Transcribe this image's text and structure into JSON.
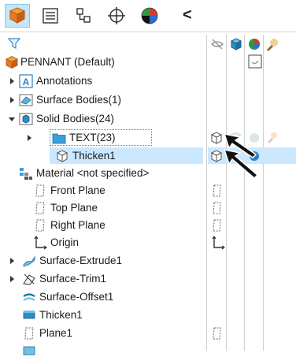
{
  "tabs": [
    {
      "icon": "feature-manager-icon",
      "active": true
    },
    {
      "icon": "property-manager-icon",
      "active": false
    },
    {
      "icon": "configuration-manager-icon",
      "active": false
    },
    {
      "icon": "dimxpert-manager-icon",
      "active": false
    },
    {
      "icon": "display-manager-icon",
      "active": false
    }
  ],
  "collapse_label": "<",
  "column_headers": [
    "hide-show-icon",
    "display-mode-icon",
    "appearance-icon",
    "transparency-icon"
  ],
  "tree": {
    "root": "PENNANT (Default)",
    "items": [
      {
        "label": "Annotations",
        "icon": "annotations-icon",
        "expander": "collapsed"
      },
      {
        "label": "Surface Bodies(1)",
        "icon": "surface-bodies-folder-icon",
        "expander": "collapsed"
      },
      {
        "label": "Solid Bodies(24)",
        "icon": "solid-bodies-folder-icon",
        "expander": "expanded"
      },
      {
        "label": "TEXT(23)",
        "icon": "folder-icon",
        "expander": "collapsed"
      },
      {
        "label": "Thicken1",
        "icon": "solid-body-icon",
        "expander": "none"
      },
      {
        "label": "Material <not specified>",
        "icon": "material-icon",
        "expander": "none"
      },
      {
        "label": "Front Plane",
        "icon": "plane-icon",
        "expander": "none"
      },
      {
        "label": "Top Plane",
        "icon": "plane-icon",
        "expander": "none"
      },
      {
        "label": "Right Plane",
        "icon": "plane-icon",
        "expander": "none"
      },
      {
        "label": "Origin",
        "icon": "origin-icon",
        "expander": "none"
      },
      {
        "label": "Surface-Extrude1",
        "icon": "surface-extrude-icon",
        "expander": "collapsed"
      },
      {
        "label": "Surface-Trim1",
        "icon": "surface-trim-icon",
        "expander": "collapsed"
      },
      {
        "label": "Surface-Offset1",
        "icon": "surface-offset-icon",
        "expander": "none"
      },
      {
        "label": "Thicken1",
        "icon": "thicken-feature-icon",
        "expander": "none"
      },
      {
        "label": "Plane1",
        "icon": "plane-icon",
        "expander": "none"
      }
    ]
  },
  "colors": {
    "selection_bg": "#cce8ff",
    "tab_active_bg": "#c6e6f7",
    "icon_blue": "#2d7fc9",
    "icon_orange": "#e7782a"
  }
}
